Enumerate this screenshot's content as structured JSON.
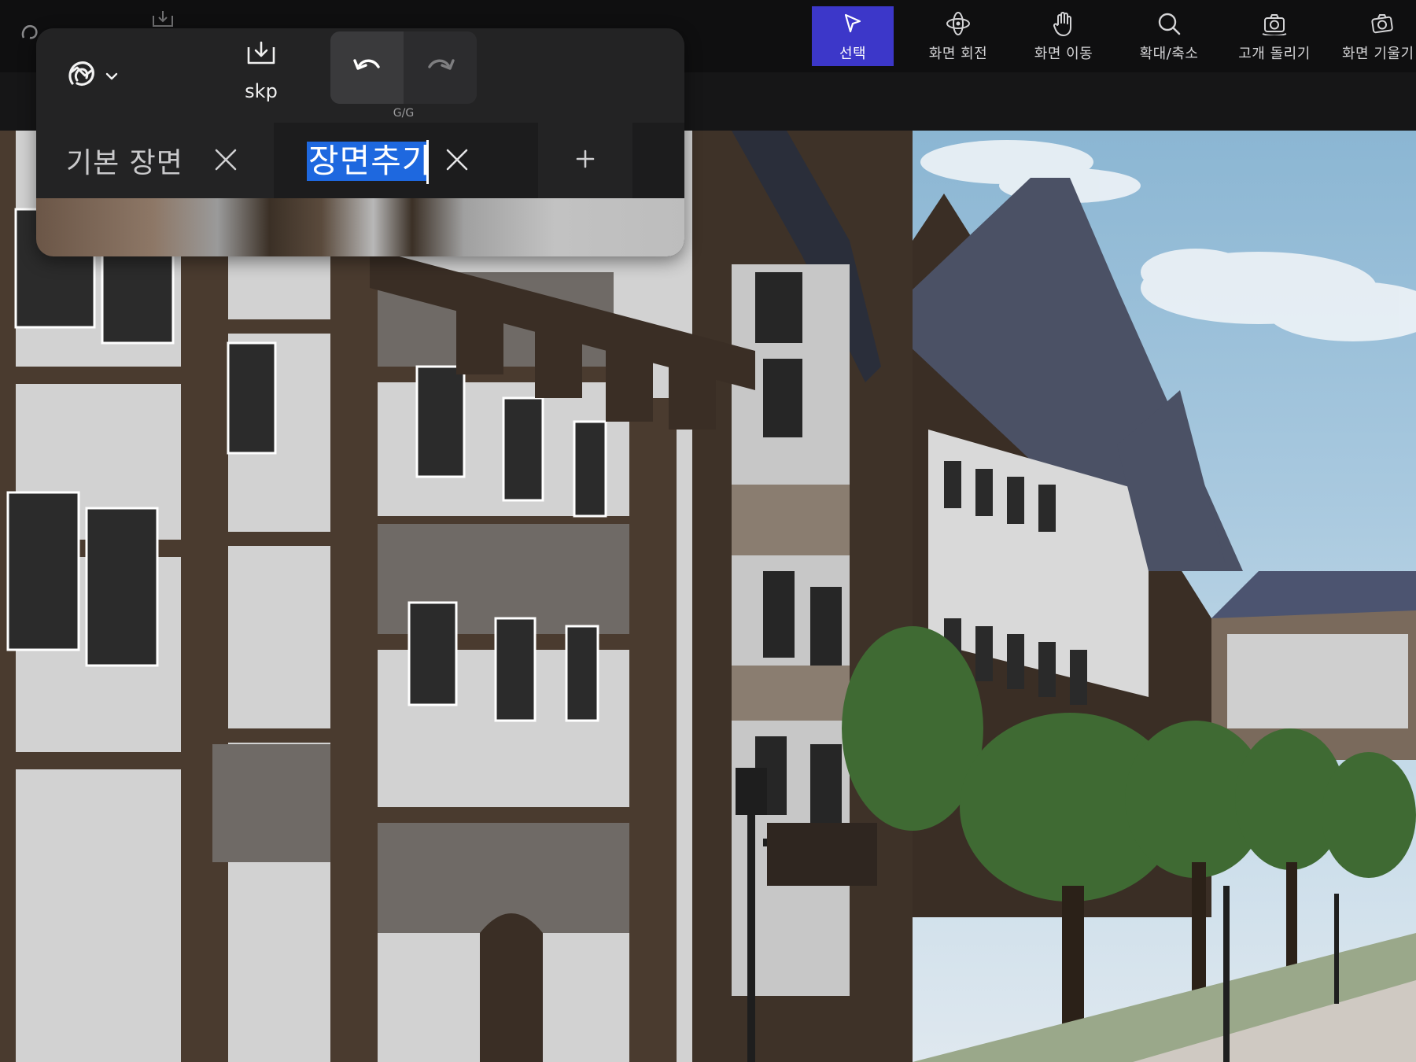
{
  "toolbar": {
    "tools": [
      {
        "id": "select",
        "label": "선택",
        "icon": "cursor-arrow-icon",
        "active": true
      },
      {
        "id": "orbit",
        "label": "화면 회전",
        "icon": "orbit-icon",
        "active": false
      },
      {
        "id": "pan",
        "label": "화면 이동",
        "icon": "hand-icon",
        "active": false
      },
      {
        "id": "zoom",
        "label": "확대/축소",
        "icon": "magnifier-icon",
        "active": false
      },
      {
        "id": "look-around",
        "label": "고개 돌리기",
        "icon": "camera-look-icon",
        "active": false
      },
      {
        "id": "tilt",
        "label": "화면 기울기",
        "icon": "camera-tilt-icon",
        "active": false
      }
    ],
    "active_color": "#3c37c9"
  },
  "panel": {
    "logo_icon": "sketch-logo-icon",
    "export": {
      "label": "skp",
      "icon": "download-tray-icon"
    },
    "history": {
      "count": "G/G",
      "undo_icon": "undo-icon",
      "redo_icon": "redo-icon"
    },
    "scenes": {
      "default_tab_label": "기본 장면",
      "new_tab_value": "장면추가",
      "add_icon": "plus-icon",
      "close_icon": "close-icon",
      "selection_color": "#1e68df"
    }
  }
}
